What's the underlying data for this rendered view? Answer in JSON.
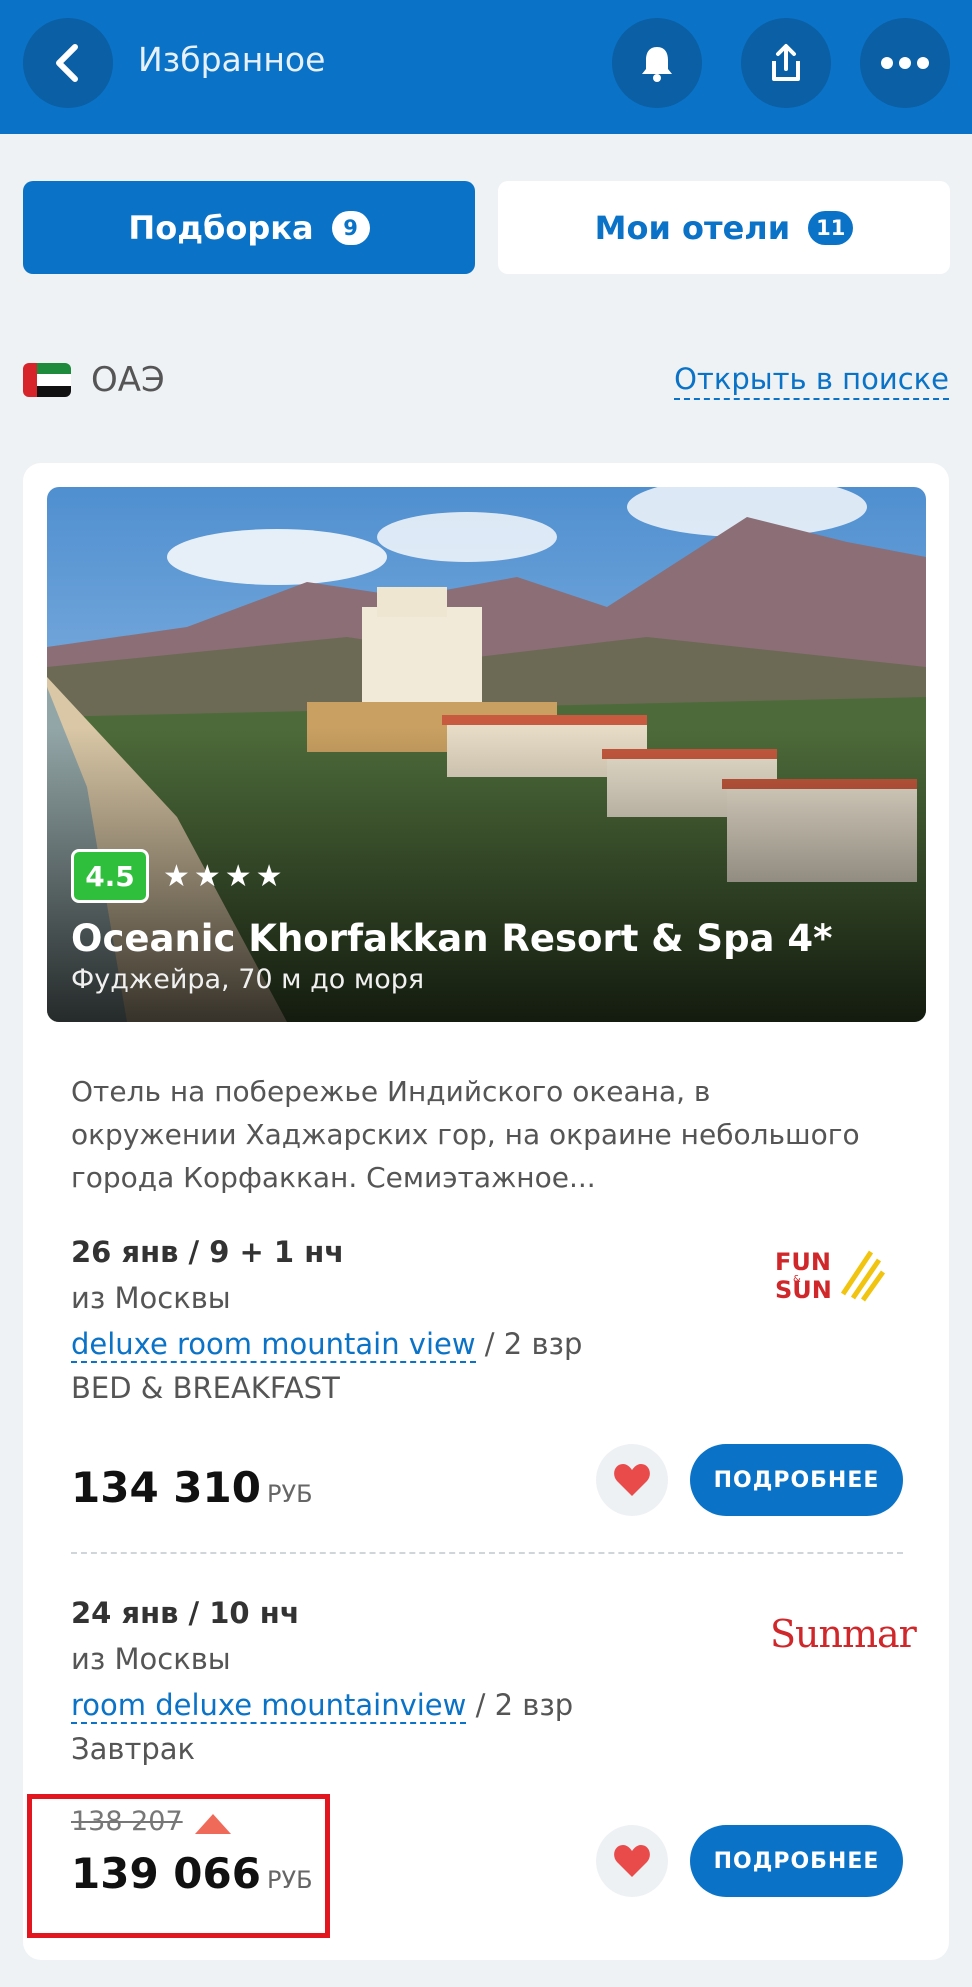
{
  "header": {
    "title": "Избранное",
    "back_icon": "back-arrow-icon",
    "bell_icon": "bell-icon",
    "share_icon": "share-icon",
    "more_icon": "more-dots-icon"
  },
  "tabs": [
    {
      "label": "Подборка",
      "count": "9",
      "active": true
    },
    {
      "label": "Мои отели",
      "count": "11",
      "active": false
    }
  ],
  "country": {
    "name": "ОАЭ",
    "open_link": "Открыть в поиске"
  },
  "hotel": {
    "rating": "4.5",
    "stars": "★★★★",
    "name": "Oceanic Khorfakkan Resort & Spa 4*",
    "location": "Фуджейра, 70 м до моря",
    "description": "Отель на побережье Индийского океана, в окружении Хаджарских гор, на окраине небольшого города Корфаккан. Семиэтажное..."
  },
  "offers": [
    {
      "dates": "26 янв / 9 + 1 нч",
      "from": "из Москвы",
      "room": "deluxe room mountain view",
      "guests": " / 2 взр",
      "meal": "BED & BREAKFAST",
      "price": "134 310",
      "currency": "РУБ",
      "button": "ПОДРОБНЕЕ",
      "operator": "FUN & SUN"
    },
    {
      "dates": "24 янв / 10 нч",
      "from": "из Москвы",
      "room": "room deluxe mountainview",
      "guests": " / 2 взр",
      "meal": "Завтрак",
      "old_price": "138 207",
      "price": "139 066",
      "currency": "РУБ",
      "button": "ПОДРОБНЕЕ",
      "operator": "Sunmar"
    }
  ],
  "colors": {
    "primary": "#0a73c7",
    "header_button": "#0b5fa5",
    "rating_green": "#2fbf3c",
    "heart": "#e94b4b",
    "highlight": "#e1161f"
  }
}
